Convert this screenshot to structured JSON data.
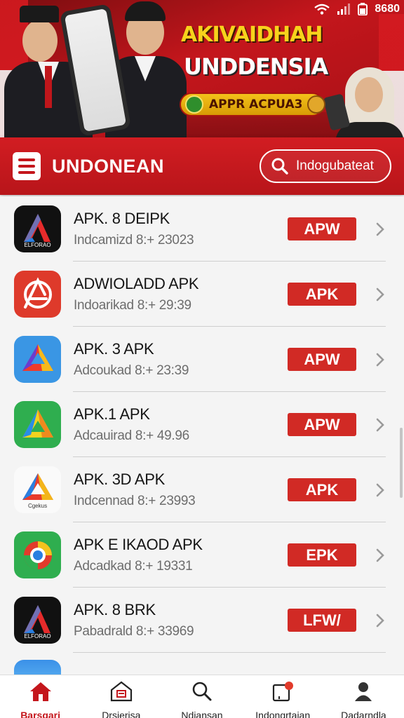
{
  "status_bar": {
    "time": "8680"
  },
  "banner": {
    "title": "AKIVAIDHAH",
    "subtitle": "UNDDENSIA",
    "pill_text": "APPR ACPUA3"
  },
  "header": {
    "title": "UNDONEAN",
    "search_text": "Indogubateat"
  },
  "colors": {
    "accent": "#c4161c",
    "tag": "#d12a25"
  },
  "apps": [
    {
      "title": "APK. 8 DEIPK",
      "subtitle": "Indcamizd 8:+ 23023",
      "tag": "APW",
      "icon": "red-a-logo-dark",
      "icon_caption": "ELFORAO"
    },
    {
      "title": "ADWIOLADD APK",
      "subtitle": "Indoarikad 8:+ 29:39",
      "tag": "APK",
      "icon": "compass-logo-red",
      "icon_caption": ""
    },
    {
      "title": "APK. 3 APK",
      "subtitle": "Adcoukad 8:+ 23:39",
      "tag": "APW",
      "icon": "triangle-logo-blue",
      "icon_caption": ""
    },
    {
      "title": "APK.1 APK",
      "subtitle": "Adcauirad 8:+ 49.96",
      "tag": "APW",
      "icon": "triangle-logo-green",
      "icon_caption": ""
    },
    {
      "title": "APK. 3D APK",
      "subtitle": "Indcennad 8:+ 23993",
      "tag": "APK",
      "icon": "triangle-logo-white",
      "icon_caption": "Cgekus"
    },
    {
      "title": "APK E IKAOD APK",
      "subtitle": "Adcadkad 8:+ 19331",
      "tag": "EPK",
      "icon": "ring-logo-green",
      "icon_caption": ""
    },
    {
      "title": "APK. 8 BRK",
      "subtitle": "Pabadrald 8:+ 33969",
      "tag": "LFW/",
      "icon": "red-a-logo-dark",
      "icon_caption": "ELFORAO"
    }
  ],
  "nav": [
    {
      "label": "Barsgari",
      "icon": "home-icon",
      "active": true
    },
    {
      "label": "Drsierisa",
      "icon": "store-icon",
      "active": false
    },
    {
      "label": "Ndiansan",
      "icon": "search-icon",
      "active": false
    },
    {
      "label": "Indongrtaian",
      "icon": "notification-icon",
      "active": false
    },
    {
      "label": "Dadarndla",
      "icon": "profile-icon",
      "active": false
    }
  ]
}
